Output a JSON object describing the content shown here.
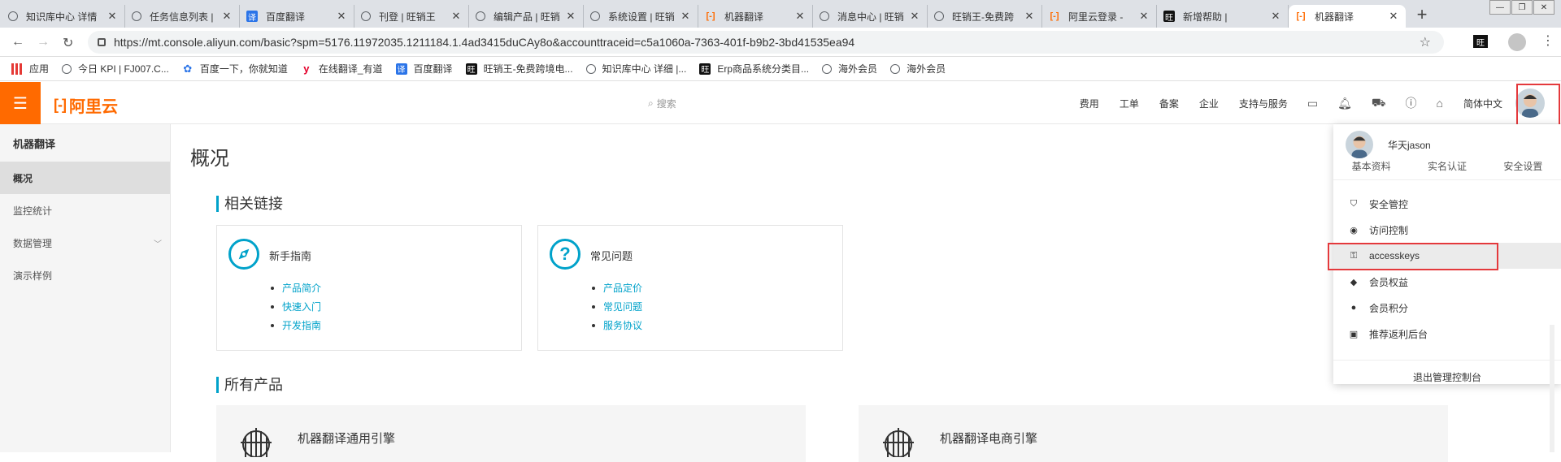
{
  "browser": {
    "tabs": [
      {
        "title": "知识库中心 详情",
        "icon": "globe-icon"
      },
      {
        "title": "任务信息列表 |",
        "icon": "globe-icon"
      },
      {
        "title": "百度翻译",
        "icon": "baidu-translate-icon"
      },
      {
        "title": "刊登 | 旺销王",
        "icon": "globe-icon"
      },
      {
        "title": "编辑产品 | 旺销",
        "icon": "globe-icon"
      },
      {
        "title": "系统设置 | 旺销",
        "icon": "globe-icon"
      },
      {
        "title": "机器翻译",
        "icon": "aliyun-icon"
      },
      {
        "title": "消息中心 | 旺销",
        "icon": "globe-icon"
      },
      {
        "title": "旺销王-免费跨",
        "icon": "globe-icon"
      },
      {
        "title": "阿里云登录 - ",
        "icon": "aliyun-icon"
      },
      {
        "title": "新增帮助 |",
        "icon": "wangxiao-icon"
      },
      {
        "title": "机器翻译",
        "icon": "aliyun-icon",
        "active": true
      }
    ],
    "url": "https://mt.console.aliyun.com/basic?spm=5176.11972035.1211184.1.4ad3415duCAy8o&accounttraceid=c5a1060a-7363-401f-b9b2-3bd41535ea94",
    "bookmarks": [
      {
        "label": "应用",
        "icon": "apps-grid-icon"
      },
      {
        "label": "今日 KPI | FJ007.C...",
        "icon": "globe-icon"
      },
      {
        "label": "百度一下，你就知道",
        "icon": "baidu-paw-icon"
      },
      {
        "label": "在线翻译_有道",
        "icon": "youdao-icon"
      },
      {
        "label": "百度翻译",
        "icon": "baidu-translate-icon"
      },
      {
        "label": "旺销王-免费跨境电...",
        "icon": "wangxiao-icon"
      },
      {
        "label": "知识库中心 详细 |...",
        "icon": "globe-icon"
      },
      {
        "label": "Erp商品系统分类目...",
        "icon": "wangxiao-icon"
      },
      {
        "label": "海外会员",
        "icon": "globe-icon"
      },
      {
        "label": "海外会员",
        "icon": "globe-icon"
      }
    ]
  },
  "header": {
    "logo_text": "阿里云",
    "search_placeholder": "搜索",
    "nav": [
      "费用",
      "工单",
      "备案",
      "企业",
      "支持与服务"
    ],
    "language": "简体中文"
  },
  "sidebar": {
    "title": "机器翻译",
    "items": [
      {
        "label": "概况",
        "active": true
      },
      {
        "label": "监控统计"
      },
      {
        "label": "数据管理",
        "has_children": true
      },
      {
        "label": "演示样例"
      }
    ]
  },
  "main": {
    "page_title": "概况",
    "related_title": "相关链接",
    "cards": [
      {
        "title": "新手指南",
        "icon": "compass-icon",
        "links": [
          "产品简介",
          "快速入门",
          "开发指南"
        ]
      },
      {
        "title": "常见问题",
        "icon": "question-icon",
        "links": [
          "产品定价",
          "常见问题",
          "服务协议"
        ]
      }
    ],
    "products_title": "所有产品",
    "products": [
      {
        "title": "机器翻译通用引擎"
      },
      {
        "title": "机器翻译电商引擎"
      }
    ]
  },
  "user_menu": {
    "username": "华天jason",
    "links": [
      "基本资料",
      "实名认证",
      "安全设置"
    ],
    "items": [
      {
        "label": "安全管控",
        "icon": "shield-icon"
      },
      {
        "label": "访问控制",
        "icon": "user-circle-icon"
      },
      {
        "label": "accesskeys",
        "icon": "key-icon",
        "highlighted": true
      },
      {
        "label": "会员权益",
        "icon": "diamond-icon"
      },
      {
        "label": "会员积分",
        "icon": "points-icon"
      },
      {
        "label": "推荐返利后台",
        "icon": "gift-icon"
      }
    ],
    "logout": "退出管理控制台"
  },
  "colors": {
    "brand": "#ff6a00",
    "accent": "#00a2ca",
    "highlight_box": "#e4393c"
  }
}
